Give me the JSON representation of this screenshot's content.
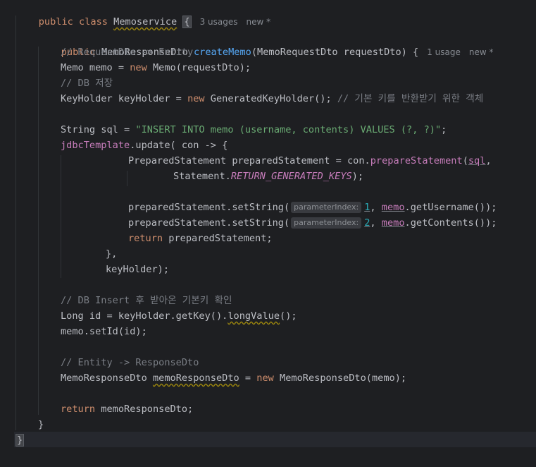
{
  "editor": {
    "class_decl": {
      "kw1": "public",
      "kw2": "class",
      "name": "Memoservice",
      "brace": "{",
      "usages": "3 usages",
      "status": "new *"
    },
    "method_decl": {
      "kw": "public",
      "type": "MemoResponseDto",
      "name": "createMemo",
      "params": "(MemoRequestDto requestDto) {",
      "usages": "1 usage",
      "status": "new *"
    },
    "lines": {
      "c1": "// RequestDto -> Entity",
      "l_memo_a": "Memo memo = ",
      "l_memo_new": "new",
      "l_memo_b": " Memo(requestDto);",
      "c2": "// DB 저장",
      "l_kh_a": "KeyHolder keyHolder = ",
      "l_kh_new": "new",
      "l_kh_b": " GeneratedKeyHolder(); ",
      "l_kh_c": "// 기본 키를 반환받기 위한 객체",
      "l_sql_a": "String sql = ",
      "l_sql_str": "\"INSERT INTO memo (username, contents) VALUES (?, ?)\"",
      "l_sql_b": ";",
      "l_jdbc_field": "jdbcTemplate",
      "l_jdbc_b": ".update( con -> {",
      "l_ps_a": "PreparedStatement preparedStatement = con.",
      "l_ps_fn": "prepareStatement",
      "l_ps_paren": "(",
      "l_ps_sql": "sql",
      "l_ps_comma": ",",
      "l_stmt_a": "Statement.",
      "l_stmt_const": "RETURN_GENERATED_KEYS",
      "l_stmt_b": ");",
      "l_set1_a": "preparedStatement.setString(",
      "l_set1_hint": "parameterIndex:",
      "l_set1_num": "1",
      "l_set1_comma": ", ",
      "l_set1_memo": "memo",
      "l_set1_b": ".getUsername());",
      "l_set2_a": "preparedStatement.setString(",
      "l_set2_hint": "parameterIndex:",
      "l_set2_num": "2",
      "l_set2_comma": ", ",
      "l_set2_memo": "memo",
      "l_set2_b": ".getContents());",
      "l_ret_kw": "return",
      "l_ret_b": " preparedStatement;",
      "l_close1": "},",
      "l_kh_arg": "keyHolder);",
      "c3": "// DB Insert 후 받아온 기본키 확인",
      "l_id_a": "Long id = keyHolder.getKey().",
      "l_id_fn": "longValue",
      "l_id_b": "();",
      "l_setid": "memo.setId(id);",
      "c4": "// Entity -> ResponseDto",
      "l_resp_a": "MemoResponseDto ",
      "l_resp_var": "memoResponseDto",
      "l_resp_b": " = ",
      "l_resp_new": "new",
      "l_resp_c": " MemoResponseDto(memo);",
      "l_return_kw": "return",
      "l_return_b": " memoResponseDto;",
      "l_method_close": "}",
      "l_class_close": "}"
    }
  }
}
